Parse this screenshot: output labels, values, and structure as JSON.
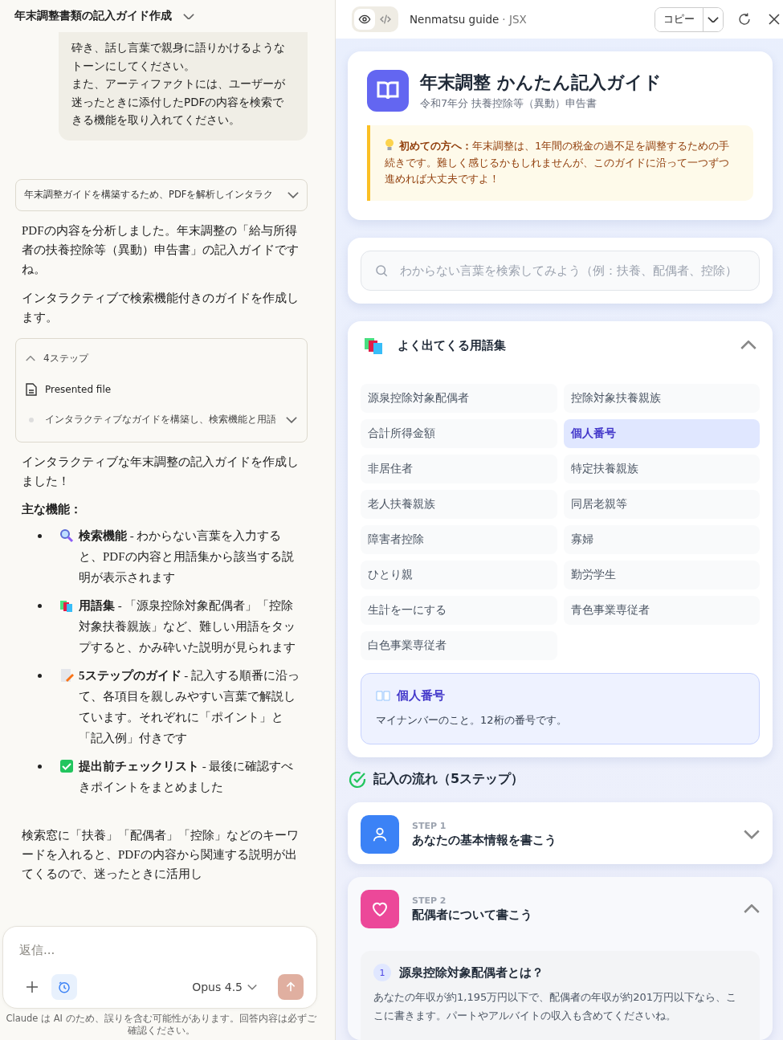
{
  "chat": {
    "title": "年末調整書類の記入ガイド作成",
    "user_message": [
      "砕き、話し言葉で親身に語りかけるようなトーンにしてください。",
      "また、アーティファクトには、ユーザーが迷ったときに添付したPDFの内容を検索できる機能を取り入れてください。"
    ],
    "thinking": {
      "label": "年末調整ガイドを構築するため、PDFを解析しインタラク",
      "expanded": false
    },
    "intro": [
      "PDFの内容を分析しました。年末調整の「給与所得者の扶養控除等（異動）申告書」の記入ガイドですね。",
      "インタラクティブで検索機能付きのガイドを作成します。"
    ],
    "steps": {
      "label": "4ステップ",
      "expanded": true,
      "items": [
        {
          "kind": "file",
          "text": "Presented file"
        },
        {
          "kind": "pending",
          "text": "インタラクティブなガイドを構築し、検索機能と用語"
        }
      ]
    },
    "summary": "インタラクティブな年末調整の記入ガイドを作成しました！",
    "features_heading": "主な機能：",
    "features": [
      {
        "kind": "search",
        "text": "**検索機能** - わからない言葉を入力すると、PDFの内容と用語集から該当する説明が表示されます"
      },
      {
        "kind": "books",
        "text": "**用語集** - 「源泉控除対象配偶者」「控除対象扶養親族」など、難しい用語をタップすると、かみ砕いた説明が見られます"
      },
      {
        "kind": "memo",
        "text": "**5ステップのガイド** - 記入する順番に沿って、各項目を親しみやすい言葉で解説しています。それぞれに「ポイント」と「記入例」付きです"
      },
      {
        "kind": "check",
        "text": "**提出前チェックリスト** - 最後に確認すべきポイントをまとめました"
      }
    ],
    "closing": "検索窓に「扶養」「配偶者」「控除」などのキーワードを入れると、PDFの内容から関連する説明が出てくるので、迷ったときに活用し",
    "composer": {
      "placeholder": "返信...",
      "model": "Opus 4.5"
    },
    "disclaimer": "Claude は AI のため、誤りを含む可能性があります。回答内容は必ずご確認ください。"
  },
  "artifact": {
    "view_tabs": [
      {
        "kind": "preview",
        "selected": true
      },
      {
        "kind": "code",
        "selected": false
      }
    ],
    "name": "Nenmatsu guide",
    "type": "· JSX",
    "copy_label": "コピー",
    "header": {
      "title": "年末調整 かんたん記入ガイド",
      "subtitle": "令和7年分 扶養控除等（異動）申告書",
      "notice": "**初めての方へ：**年末調整は、1年間の税金の過不足を調整するための手続きです。難しく感じるかもしれませんが、このガイドに沿って一つずつ進めれば大丈夫ですよ！"
    },
    "search": {
      "placeholder": "わからない言葉を検索してみよう（例：扶養、配偶者、控除）"
    },
    "glossary": {
      "title": "よく出てくる用語集",
      "expanded": true,
      "terms": [
        {
          "label": "源泉控除対象配偶者",
          "selected": false
        },
        {
          "label": "控除対象扶養親族",
          "selected": false
        },
        {
          "label": "合計所得金額",
          "selected": false
        },
        {
          "label": "個人番号",
          "selected": true
        },
        {
          "label": "非居住者",
          "selected": false
        },
        {
          "label": "特定扶養親族",
          "selected": false
        },
        {
          "label": "老人扶養親族",
          "selected": false
        },
        {
          "label": "同居老親等",
          "selected": false
        },
        {
          "label": "障害者控除",
          "selected": false
        },
        {
          "label": "寡婦",
          "selected": false
        },
        {
          "label": "ひとり親",
          "selected": false
        },
        {
          "label": "勤労学生",
          "selected": false
        },
        {
          "label": "生計を一にする",
          "selected": false
        },
        {
          "label": "青色事業専従者",
          "selected": false
        },
        {
          "label": "白色事業専従者",
          "selected": false
        }
      ],
      "definition": {
        "title": "個人番号",
        "text": "マイナンバーのこと。12桁の番号です。"
      }
    },
    "flow_title": "記入の流れ（5ステップ）",
    "steps": [
      {
        "kind": "person",
        "step": "STEP 1",
        "title": "あなたの基本情報を書こう",
        "expanded": false,
        "color": "#3b82f6"
      },
      {
        "kind": "heart",
        "step": "STEP 2",
        "title": "配偶者について書こう",
        "expanded": true,
        "color": "#ec4899",
        "items": [
          {
            "number": "1",
            "title": "源泉控除対象配偶者とは？",
            "text": "あなたの年収が約1,195万円以下で、配偶者の年収が約201万円以下なら、ここに書きます。パートやアルバイトの収入も含めてくださいね。"
          }
        ]
      }
    ]
  }
}
